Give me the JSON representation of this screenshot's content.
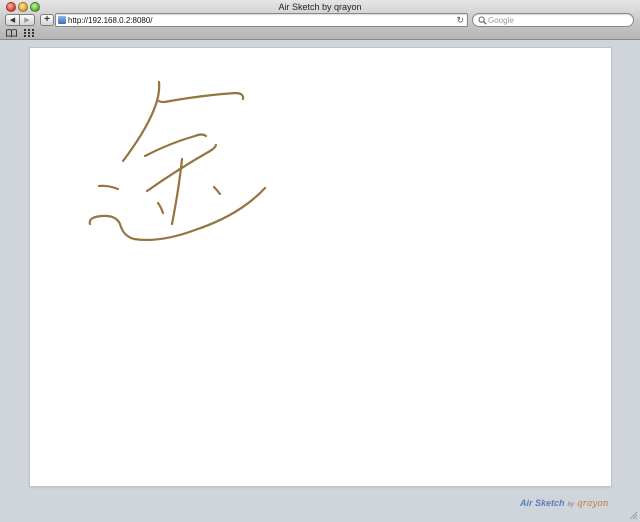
{
  "window": {
    "title": "Air Sketch by qrayon"
  },
  "toolbar": {
    "back_icon": "◀",
    "forward_icon": "▶",
    "add_label": "+",
    "url": "http://192.168.0.2:8080/",
    "reload_icon": "↻",
    "search_icon": "🔍",
    "search_placeholder": "Google"
  },
  "sketch": {
    "stroke_color": "#957440"
  },
  "footer": {
    "app_name": "Air Sketch",
    "by": "by",
    "author": "qrayon"
  }
}
